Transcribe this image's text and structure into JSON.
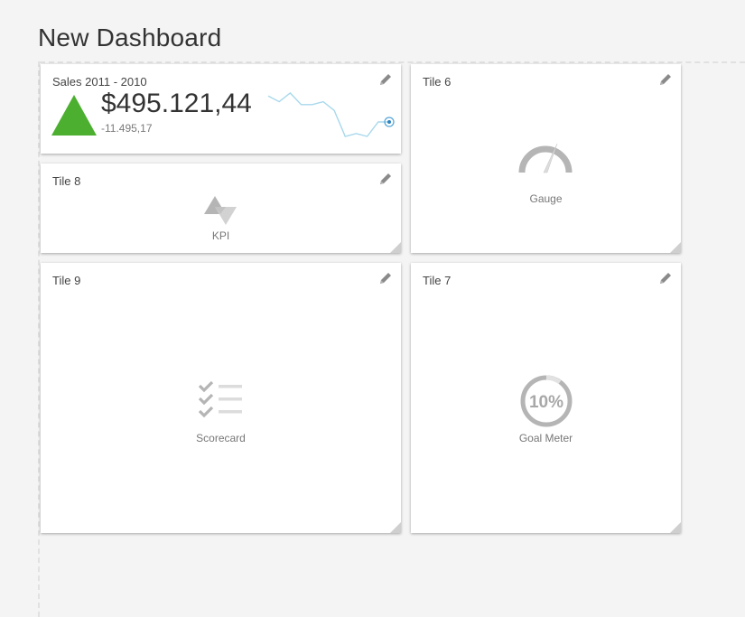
{
  "dashboard": {
    "title": "New Dashboard"
  },
  "tiles": {
    "sales": {
      "title": "Sales 2011 - 2010",
      "value": "$495.121,44",
      "delta": "-11.495,17",
      "trend": "up",
      "trend_color": "#4caf30",
      "sparkline_color": "#a8d8ec",
      "sparkline": [
        72,
        70,
        73,
        69,
        69,
        70,
        67,
        58,
        59,
        58,
        63,
        63
      ]
    },
    "tile6": {
      "title": "Tile 6",
      "placeholder": "Gauge",
      "icon": "gauge-icon"
    },
    "tile8": {
      "title": "Tile 8",
      "placeholder": "KPI",
      "icon": "kpi-icon"
    },
    "tile9": {
      "title": "Tile 9",
      "placeholder": "Scorecard",
      "icon": "scorecard-icon"
    },
    "tile7": {
      "title": "Tile 7",
      "placeholder": "Goal Meter",
      "icon": "goal-meter-icon",
      "goal_text": "10%"
    }
  },
  "colors": {
    "background": "#f4f4f4",
    "tile": "#ffffff",
    "placeholder_icon": "#b5b5b5",
    "edit_icon": "#8a8a8a"
  }
}
